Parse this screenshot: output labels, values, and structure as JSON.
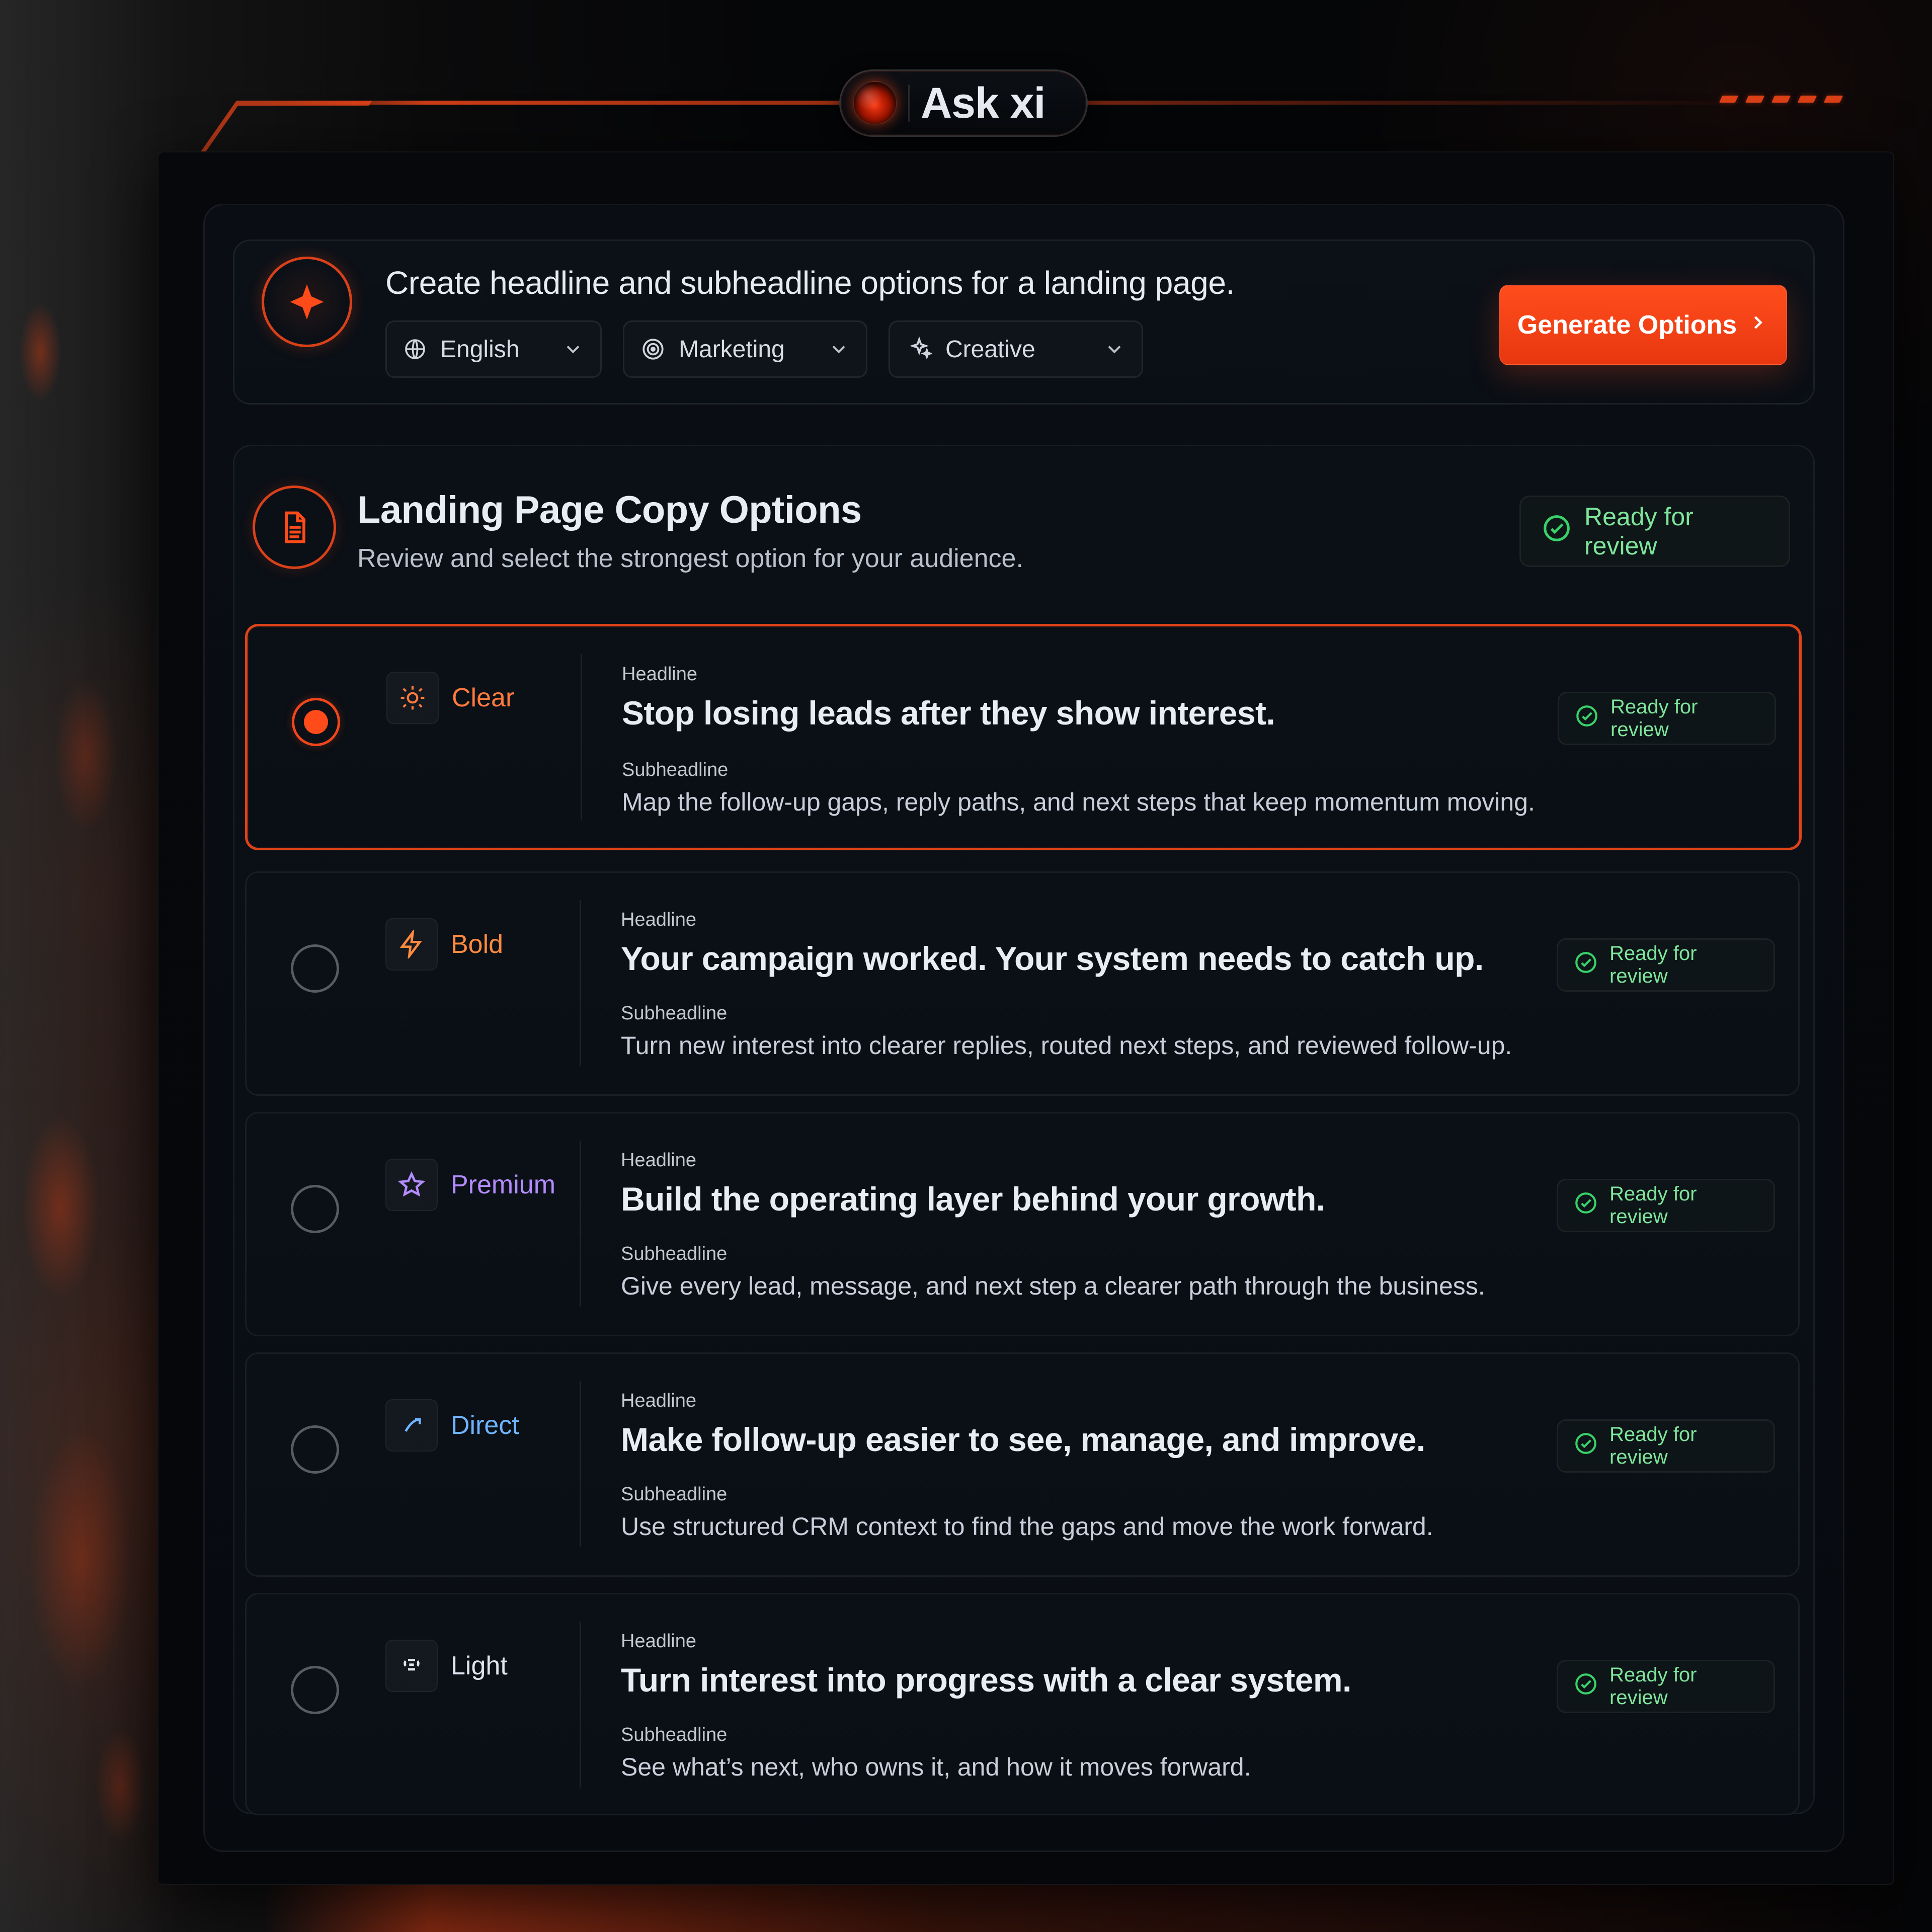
{
  "app": {
    "title": "Ask xi",
    "colors": {
      "accent": "#ff4a1a",
      "success": "#39d26a",
      "purple": "#b48cff",
      "blue": "#6fb4ff"
    }
  },
  "prompt": {
    "text": "Create headline and subheadline options for a landing page.",
    "selects": [
      {
        "label": "English",
        "icon": "globe-icon"
      },
      {
        "label": "Marketing",
        "icon": "target-icon"
      },
      {
        "label": "Creative",
        "icon": "sparkles-icon"
      }
    ],
    "cta_label": "Generate Options"
  },
  "results": {
    "title": "Landing Page Copy Options",
    "subtitle": "Review and select the strongest option for your audience.",
    "status": "Ready for review",
    "options": [
      {
        "tone": "Clear",
        "tone_icon": "sun-icon",
        "selected": true,
        "headline_label": "Headline",
        "headline": "Stop losing leads after they show interest.",
        "subheadline_label": "Subheadline",
        "subheadline": "Map the follow-up gaps, reply paths, and next steps that keep momentum moving.",
        "status": "Ready for review"
      },
      {
        "tone": "Bold",
        "tone_icon": "lightning-icon",
        "selected": false,
        "headline_label": "Headline",
        "headline": "Your campaign worked. Your system needs to catch up.",
        "subheadline_label": "Subheadline",
        "subheadline": "Turn new interest into clearer replies, routed next steps, and reviewed follow-up.",
        "status": "Ready for review"
      },
      {
        "tone": "Premium",
        "tone_icon": "star-icon",
        "selected": false,
        "headline_label": "Headline",
        "headline": "Build the operating layer behind your growth.",
        "subheadline_label": "Subheadline",
        "subheadline": "Give every lead, message, and next step a clearer path through the business.",
        "status": "Ready for review"
      },
      {
        "tone": "Direct",
        "tone_icon": "arrow-icon",
        "selected": false,
        "headline_label": "Headline",
        "headline": "Make follow-up easier to see, manage, and improve.",
        "subheadline_label": "Subheadline",
        "subheadline": "Use structured CRM context to find the gaps and move the work forward.",
        "status": "Ready for review"
      },
      {
        "tone": "Light",
        "tone_icon": "light-icon",
        "selected": false,
        "headline_label": "Headline",
        "headline": "Turn interest into progress with a clear system.",
        "subheadline_label": "Subheadline",
        "subheadline": "See what’s next, who owns it, and how it moves forward.",
        "status": "Ready for review"
      }
    ]
  }
}
